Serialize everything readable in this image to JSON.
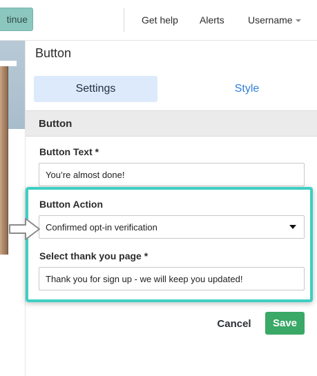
{
  "topbar": {
    "continue_label": "tinue",
    "nav": {
      "help": "Get help",
      "alerts": "Alerts",
      "username": "Username"
    }
  },
  "panel": {
    "title": "Button",
    "tabs": {
      "settings": "Settings",
      "style": "Style"
    },
    "section_title": "Button",
    "fields": {
      "button_text": {
        "label": "Button Text",
        "required": "*",
        "value": "You’re almost done!"
      },
      "button_action": {
        "label": "Button Action",
        "selected": "Confirmed opt-in verification"
      },
      "thank_you_page": {
        "label": "Select thank you page",
        "required": "*",
        "value": "Thank you for sign up - we will keep you updated!"
      }
    },
    "actions": {
      "cancel": "Cancel",
      "save": "Save"
    }
  },
  "colors": {
    "highlight": "#3ecfc2",
    "save_button": "#3aa866",
    "active_tab_bg": "#dceafb",
    "link_blue": "#2f7fd6",
    "continue_button": "#8cc7bf"
  },
  "icons": {
    "username_caret": "caret-down-icon",
    "select_caret": "triangle-down-icon",
    "pointer": "arrow-right-icon"
  }
}
